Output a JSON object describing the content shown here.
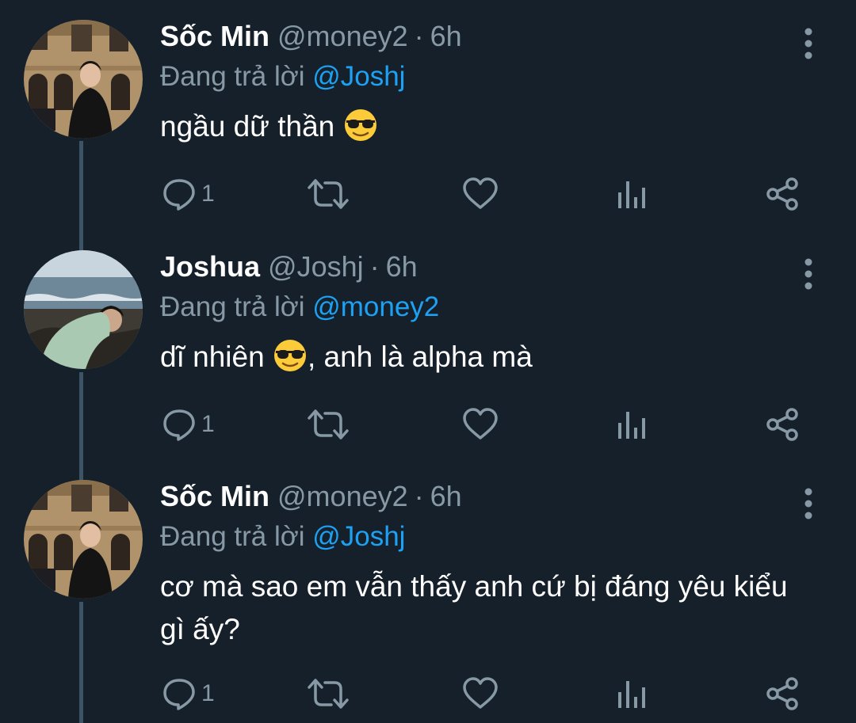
{
  "colors": {
    "background": "#15202b",
    "text_primary": "#ffffff",
    "text_secondary": "#8899a6",
    "accent": "#1da1f2",
    "thread_line": "#3d5466"
  },
  "tweets": [
    {
      "name": "Sốc Min",
      "handle": "@money2",
      "separator": "·",
      "time": "6h",
      "reply_prefix": "Đang trả lời",
      "reply_mention": "@Joshj",
      "text_before": "ngầu dữ thần",
      "emoji": "smiling-face-with-sunglasses",
      "text_after": "",
      "reply_count": "1",
      "avatar": "man-in-front-of-building-avatar"
    },
    {
      "name": "Joshua",
      "handle": "@Joshj",
      "separator": "·",
      "time": "6h",
      "reply_prefix": "Đang trả lời",
      "reply_mention": "@money2",
      "text_before": "dĩ nhiên",
      "emoji": "smiling-face-with-sunglasses",
      "text_after": ", anh là alpha mà",
      "reply_count": "1",
      "avatar": "person-at-beach-avatar"
    },
    {
      "name": "Sốc Min",
      "handle": "@money2",
      "separator": "·",
      "time": "6h",
      "reply_prefix": "Đang trả lời",
      "reply_mention": "@Joshj",
      "text_before": "cơ mà sao em vẫn thấy anh cứ bị đáng yêu kiểu gì ấy?",
      "emoji": "",
      "text_after": "",
      "reply_count": "1",
      "avatar": "man-in-front-of-building-avatar"
    }
  ],
  "icons": {
    "reply": "reply-bubble-icon",
    "retweet": "retweet-icon",
    "like": "heart-icon",
    "analytics": "bar-chart-icon",
    "share": "share-icon",
    "more": "more-vertical-icon"
  }
}
